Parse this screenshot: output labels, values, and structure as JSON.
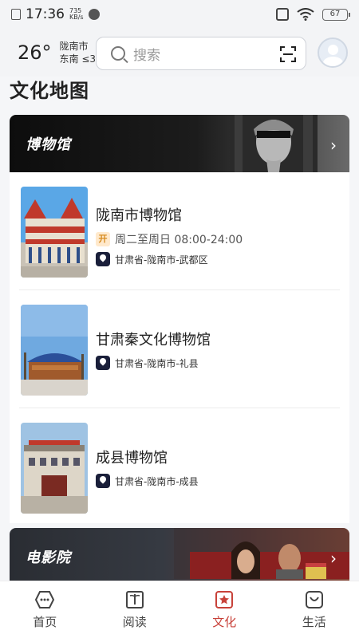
{
  "status_bar": {
    "time": "17:36",
    "net_speed_value": "735",
    "net_speed_unit": "KB/s",
    "battery": "67"
  },
  "header": {
    "temperature": "26°",
    "location_city": "陇南市",
    "location_wind": "东南 ≤3",
    "search_placeholder": "搜索"
  },
  "page": {
    "title": "文化地图"
  },
  "sections": {
    "museum_title": "博物馆",
    "cinema_title": "电影院"
  },
  "museums": [
    {
      "name": "陇南市博物馆",
      "open_badge": "开",
      "hours": "周二至周日 08:00-24:00",
      "location": "甘肃省-陇南市-武都区"
    },
    {
      "name": "甘肃秦文化博物馆",
      "location": "甘肃省-陇南市-礼县"
    },
    {
      "name": "成县博物馆",
      "location": "甘肃省-陇南市-成县"
    }
  ],
  "bottom_nav": [
    {
      "label": "首页"
    },
    {
      "label": "阅读"
    },
    {
      "label": "文化",
      "active": true
    },
    {
      "label": "生活"
    }
  ],
  "colors": {
    "accent": "#c8423a",
    "banner_dark": "#0d0d0d",
    "location_badge": "#1a1f3a"
  }
}
